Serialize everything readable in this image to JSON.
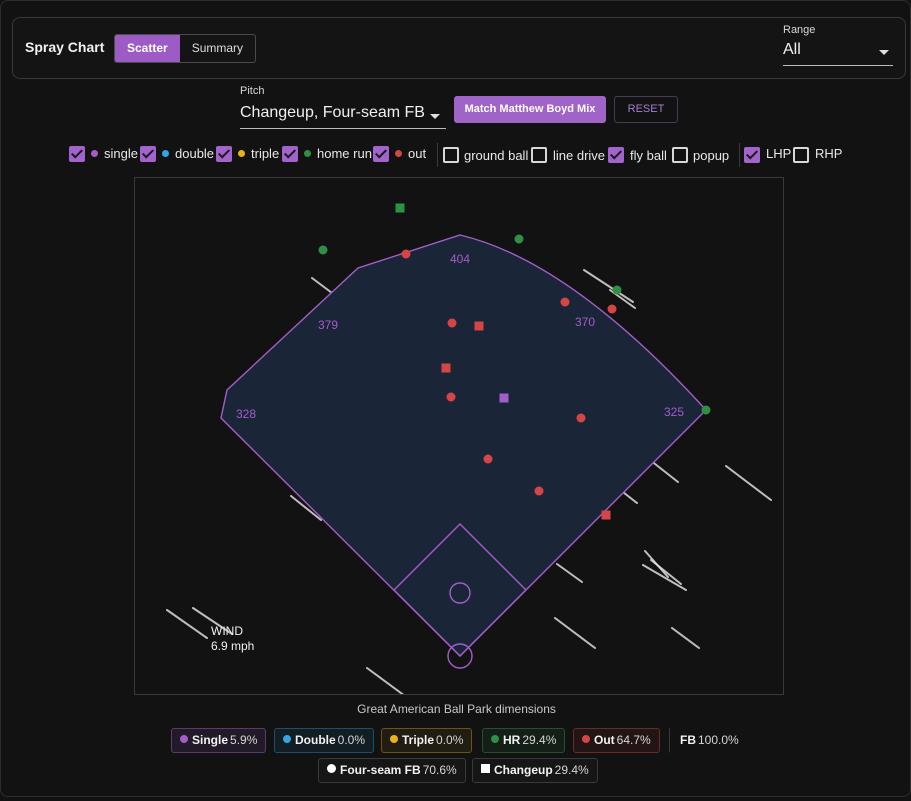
{
  "header": {
    "title": "Spray Chart",
    "tabs": [
      {
        "label": "Scatter",
        "active": true
      },
      {
        "label": "Summary",
        "active": false
      }
    ],
    "range": {
      "label": "Range",
      "value": "All"
    }
  },
  "pitch_filter": {
    "label": "Pitch",
    "value": "Changeup, Four-seam FB"
  },
  "buttons": {
    "match": "Match Matthew Boyd Mix",
    "reset": "RESET"
  },
  "colors": {
    "accent": "#a263cc",
    "single": "#a35dc8",
    "double": "#2fa6e6",
    "triple": "#e9b21a",
    "home_run": "#2f8f45",
    "out": "#d64545",
    "field_fill": "#1b2538",
    "field_line": "#a35dc8"
  },
  "filters": {
    "outcomes": [
      {
        "label": "single",
        "checked": true,
        "color_key": "single"
      },
      {
        "label": "double",
        "checked": true,
        "color_key": "double"
      },
      {
        "label": "triple",
        "checked": true,
        "color_key": "triple"
      },
      {
        "label": "home run",
        "checked": true,
        "color_key": "home_run"
      },
      {
        "label": "out",
        "checked": true,
        "color_key": "out"
      }
    ],
    "batted_ball": [
      {
        "label": "ground ball",
        "checked": false
      },
      {
        "label": "line drive",
        "checked": false
      },
      {
        "label": "fly ball",
        "checked": true
      },
      {
        "label": "popup",
        "checked": false
      }
    ],
    "hand": [
      {
        "label": "LHP",
        "checked": true
      },
      {
        "label": "RHP",
        "checked": false
      }
    ]
  },
  "field": {
    "distance_labels": [
      "328",
      "379",
      "404",
      "370",
      "325"
    ],
    "wind": {
      "label": "WIND",
      "speed": "6.9 mph"
    },
    "caption": "Great American Ball Park dimensions"
  },
  "batted_balls": [
    {
      "outcome": "home_run",
      "pitch": "changeup"
    },
    {
      "outcome": "home_run",
      "pitch": "four_seam"
    },
    {
      "outcome": "home_run",
      "pitch": "four_seam"
    },
    {
      "outcome": "home_run",
      "pitch": "four_seam"
    },
    {
      "outcome": "home_run",
      "pitch": "four_seam"
    },
    {
      "outcome": "out",
      "pitch": "four_seam"
    },
    {
      "outcome": "out",
      "pitch": "four_seam"
    },
    {
      "outcome": "out",
      "pitch": "four_seam"
    },
    {
      "outcome": "out",
      "pitch": "four_seam"
    },
    {
      "outcome": "out",
      "pitch": "changeup"
    },
    {
      "outcome": "out",
      "pitch": "changeup"
    },
    {
      "outcome": "out",
      "pitch": "four_seam"
    },
    {
      "outcome": "out",
      "pitch": "four_seam"
    },
    {
      "outcome": "out",
      "pitch": "four_seam"
    },
    {
      "outcome": "out",
      "pitch": "four_seam"
    },
    {
      "outcome": "out",
      "pitch": "changeup"
    },
    {
      "outcome": "single",
      "pitch": "changeup"
    }
  ],
  "summary": {
    "outcomes": [
      {
        "label": "Single",
        "pct": "5.9%",
        "color_key": "single"
      },
      {
        "label": "Double",
        "pct": "0.0%",
        "color_key": "double"
      },
      {
        "label": "Triple",
        "pct": "0.0%",
        "color_key": "triple"
      },
      {
        "label": "HR",
        "pct": "29.4%",
        "color_key": "home_run"
      },
      {
        "label": "Out",
        "pct": "64.7%",
        "color_key": "out"
      }
    ],
    "fb": {
      "label": "FB",
      "pct": "100.0%"
    },
    "pitches": [
      {
        "label": "Four-seam FB",
        "pct": "70.6%",
        "marker": "circle"
      },
      {
        "label": "Changeup",
        "pct": "29.4%",
        "marker": "square"
      }
    ]
  }
}
